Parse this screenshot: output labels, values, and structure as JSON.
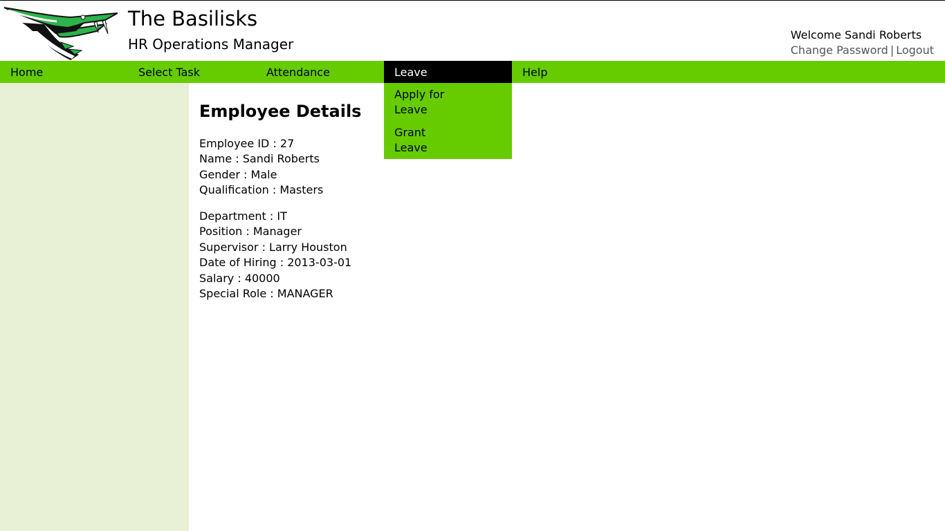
{
  "header": {
    "title": "The Basilisks",
    "subtitle": "HR Operations Manager",
    "logo_icon": "basilisk-snake-logo",
    "welcome": "Welcome Sandi Roberts",
    "change_password": "Change Password",
    "separator": "|",
    "logout": "Logout"
  },
  "nav": {
    "items": [
      {
        "label": "Home"
      },
      {
        "label": "Select Task"
      },
      {
        "label": "Attendance"
      },
      {
        "label": "Leave"
      },
      {
        "label": "Help"
      }
    ],
    "active": "Leave",
    "dropdown": [
      {
        "label": "Apply for Leave"
      },
      {
        "label": "Grant Leave"
      }
    ]
  },
  "employee": {
    "title": "Employee Details",
    "personal": [
      {
        "text": "Employee ID : 27"
      },
      {
        "text": "Name : Sandi Roberts"
      },
      {
        "text": "Gender : Male"
      },
      {
        "text": "Qualification : Masters"
      }
    ],
    "job": [
      {
        "text": "Department : IT"
      },
      {
        "text": "Position : Manager"
      },
      {
        "text": "Supervisor : Larry Houston"
      },
      {
        "text": "Date of Hiring : 2013-03-01"
      },
      {
        "text": "Salary : 40000"
      },
      {
        "text": "Special Role : MANAGER"
      }
    ]
  },
  "colors": {
    "nav_bg": "#66cc00",
    "nav_active_bg": "#000000",
    "sidebar_bg": "#e8f1d6",
    "logo_green": "#2db34a"
  }
}
